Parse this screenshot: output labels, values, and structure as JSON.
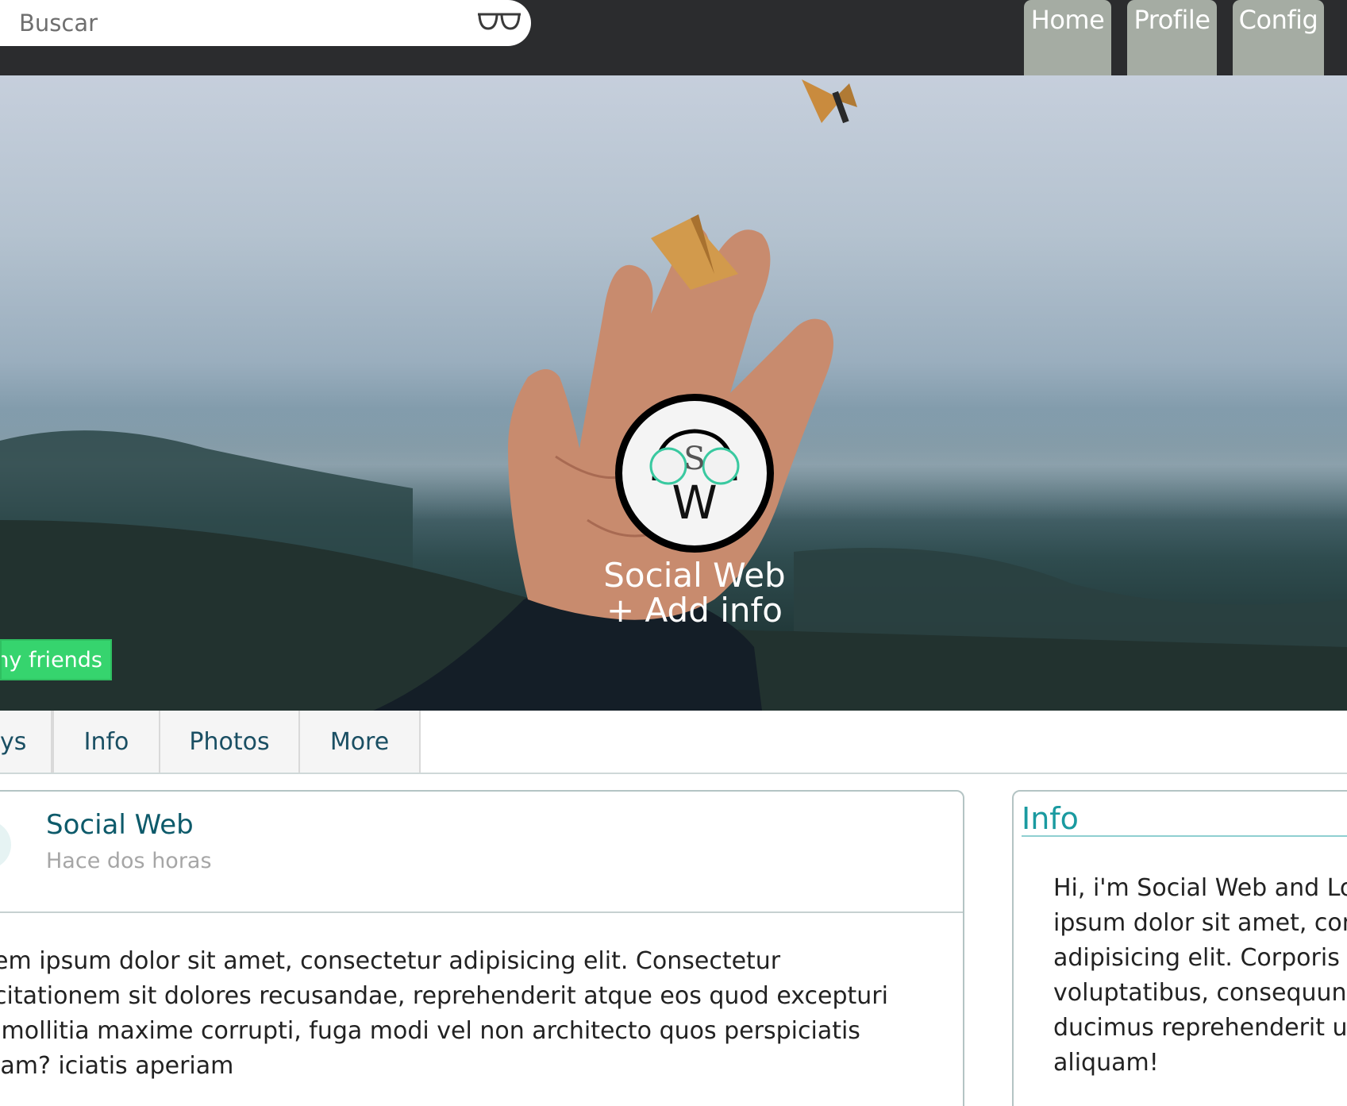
{
  "search": {
    "placeholder": "Buscar",
    "icon": "glasses-icon"
  },
  "nav": {
    "items": [
      {
        "label": "Home"
      },
      {
        "label": "Profile"
      },
      {
        "label": "Config"
      }
    ]
  },
  "cover": {
    "avatar_letters": {
      "top": "S",
      "bottom": "W"
    },
    "name": "Social Web",
    "add_info": "+ Add info",
    "friends_button": "my friends"
  },
  "tabs": [
    {
      "label": "ys"
    },
    {
      "label": "Info"
    },
    {
      "label": "Photos"
    },
    {
      "label": "More"
    }
  ],
  "post": {
    "author": "Social Web",
    "time": "Hace dos horas",
    "lines": [
      "em ipsum dolor sit amet, consectetur adipisicing elit. Consectetur",
      "citationem sit dolores recusandae, reprehenderit atque eos quod excepturi",
      " mollitia maxime corrupti, fuga modi vel non architecto quos perspiciatis",
      "iam? iciatis aperiam"
    ]
  },
  "info": {
    "title": "Info",
    "lines": [
      "Hi, i'm Social Web and Lo",
      "ipsum dolor sit amet, con",
      "adipisicing elit. Corporis",
      "voluptatibus, consequunt",
      "ducimus reprehenderit ul",
      "aliquam!"
    ]
  },
  "colors": {
    "topbar": "#2b2c2e",
    "nav_tab": "#a5aca3",
    "friends_green": "#36d46e",
    "accent_teal": "#1a9aa0",
    "tab_text": "#1a4f63"
  }
}
